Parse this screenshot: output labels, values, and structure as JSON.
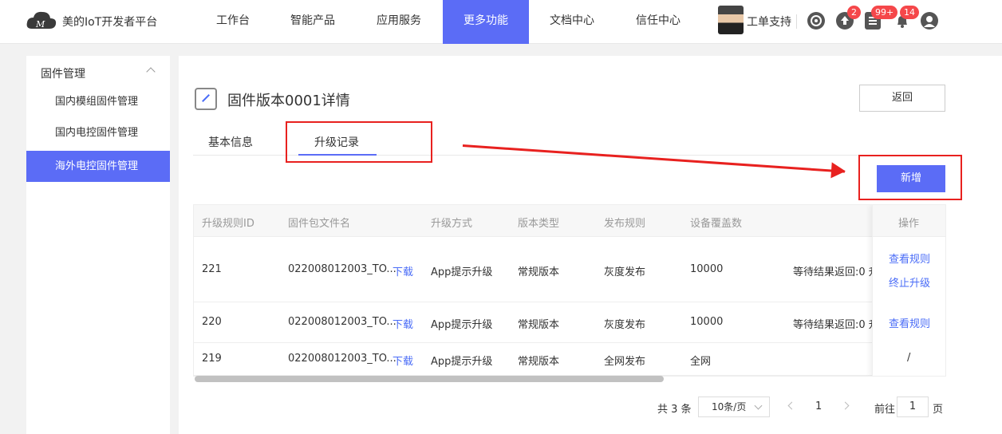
{
  "nav": {
    "brand": "美的IoT开发者平台",
    "items": [
      "工作台",
      "智能产品",
      "应用服务",
      "更多功能",
      "文档中心",
      "信任中心"
    ],
    "active": "更多功能",
    "user_label": "工单支持",
    "badges": [
      "2",
      "99+",
      "14"
    ]
  },
  "sidebar": {
    "section": "固件管理",
    "items": [
      "国内模组固件管理",
      "国内电控固件管理",
      "海外电控固件管理"
    ]
  },
  "page": {
    "title": "固件版本0001详情",
    "back_label": "返回",
    "tabs": [
      "基本信息",
      "升级记录"
    ],
    "add_label": "新增"
  },
  "table": {
    "headers": [
      "升级规则ID",
      "固件包文件名",
      "升级方式",
      "版本类型",
      "发布规则",
      "设备覆盖数",
      "操作"
    ],
    "rows": [
      {
        "id": "221",
        "file": "022008012003_TO...",
        "download": "下载",
        "method": "App提示升级",
        "type": "常规版本",
        "rule": "灰度发布",
        "count": "10000",
        "status": "等待结果返回:0 升",
        "op1": "查看规则",
        "op2": "终止升级"
      },
      {
        "id": "220",
        "file": "022008012003_TO...",
        "download": "下载",
        "method": "App提示升级",
        "type": "常规版本",
        "rule": "灰度发布",
        "count": "10000",
        "status": "等待结果返回:0 升",
        "op1": "查看规则"
      },
      {
        "id": "219",
        "file": "022008012003_TO...",
        "download": "下载",
        "method": "App提示升级",
        "type": "常规版本",
        "rule": "全网发布",
        "count": "全网",
        "op1": "/"
      }
    ]
  },
  "pagination": {
    "total": "共 3 条",
    "page_size": "10条/页",
    "current": "1",
    "goto_label": "前往",
    "goto_value": "1",
    "page_unit": "页"
  },
  "colors": {
    "accent": "#5b6cf6",
    "highlight": "#e8211f",
    "link": "#4a6cf7"
  }
}
